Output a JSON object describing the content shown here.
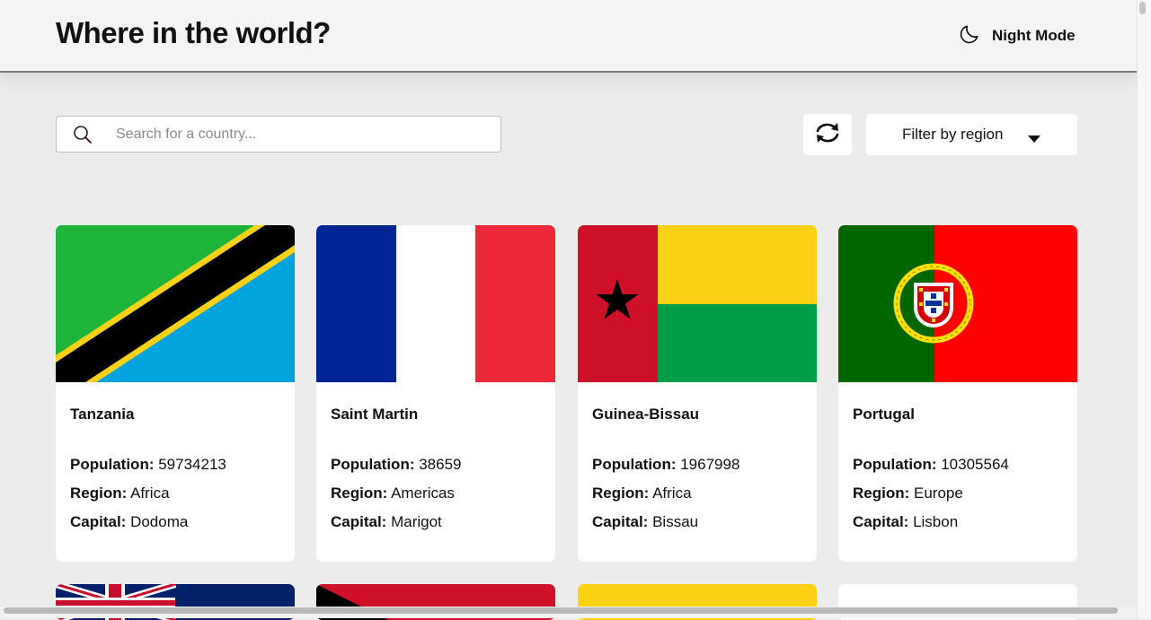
{
  "header": {
    "title": "Where in the world?",
    "theme_toggle_label": "Night Mode",
    "theme_icon": "moon-icon"
  },
  "search": {
    "placeholder": "Search for a country...",
    "value": "",
    "icon": "search-icon"
  },
  "toolbar": {
    "refresh_icon": "refresh-icon",
    "filter_label": "Filter by region",
    "filter_icon": "caret-down-icon"
  },
  "labels": {
    "population": "Population:",
    "region": "Region:",
    "capital": "Capital:"
  },
  "countries": [
    {
      "name": "Tanzania",
      "population": "59734213",
      "region": "Africa",
      "capital": "Dodoma"
    },
    {
      "name": "Saint Martin",
      "population": "38659",
      "region": "Americas",
      "capital": "Marigot"
    },
    {
      "name": "Guinea-Bissau",
      "population": "1967998",
      "region": "Africa",
      "capital": "Bissau"
    },
    {
      "name": "Portugal",
      "population": "10305564",
      "region": "Europe",
      "capital": "Lisbon"
    }
  ],
  "colors": {
    "background": "#ececec",
    "card": "#ffffff",
    "text": "#111111"
  }
}
